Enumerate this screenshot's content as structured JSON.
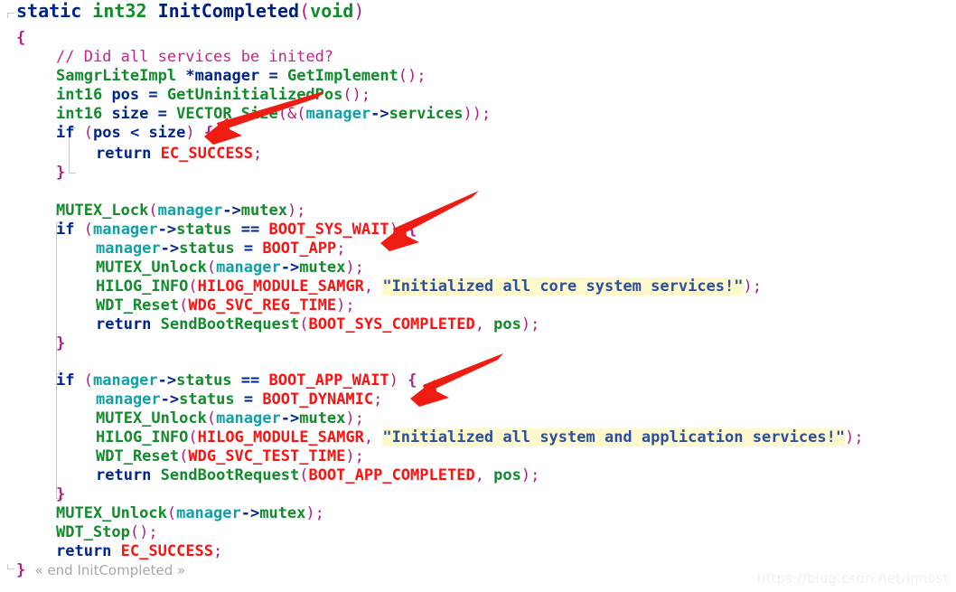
{
  "editor": {
    "language": "C",
    "background_color": "#ffffff",
    "fold_marker": "« end InitCompleted »"
  },
  "theme": {
    "keyword_color": "#00258c",
    "type_color": "#128b2b",
    "function_color": "#128b2b",
    "constant_color": "#ff1111",
    "punctuation_color": "#b0208c",
    "comment_color": "#c2258a",
    "string_color": "#2b4fa2",
    "string_highlight_bg": "#fdf9cc",
    "field_color": "#0fa0a8",
    "fold_guide_color": "#c8c8c8",
    "annotation_color": "#ee1c12",
    "watermark_color": "#f0f0f0"
  },
  "code": {
    "line01": {
      "kw_static": "static",
      "type_int32": "int32",
      "fn_name": "InitCompleted",
      "paren_open": "(",
      "type_void": "void",
      "paren_close": ")"
    },
    "line02": {
      "brace_open": "{"
    },
    "line03": {
      "comment": "// Did all services be inited?"
    },
    "line04": {
      "type": "SamgrLiteImpl",
      "star": "*",
      "var": "manager",
      "eq": "=",
      "fn": "GetImplement",
      "tail": "();"
    },
    "line05": {
      "type": "int16",
      "var": "pos",
      "eq": "=",
      "fn": "GetUninitializedPos",
      "tail": "();"
    },
    "line06": {
      "type": "int16",
      "var": "size",
      "eq": "=",
      "fn": "VECTOR_Size",
      "open": "(&(",
      "obj": "manager",
      "arrow": "->",
      "member": "services",
      "close": "));"
    },
    "line07": {
      "kw_if": "if",
      "open": "(",
      "a": "pos",
      "op": "<",
      "b": "size",
      "close": ")",
      "brace": "{"
    },
    "line08": {
      "kw_return": "return",
      "const": "EC_SUCCESS",
      "semi": ";"
    },
    "line09": {
      "brace_close": "}"
    },
    "line11": {
      "fn": "MUTEX_Lock",
      "open": "(",
      "obj": "manager",
      "arrow": "->",
      "member": "mutex",
      "close": ");"
    },
    "line12": {
      "kw_if": "if",
      "open": "(",
      "obj": "manager",
      "arrow": "->",
      "member": "status",
      "op": "==",
      "const": "BOOT_SYS_WAIT",
      "close": ")",
      "brace": "{"
    },
    "line13": {
      "obj": "manager",
      "arrow": "->",
      "member": "status",
      "eq": "=",
      "const": "BOOT_APP",
      "semi": ";"
    },
    "line14": {
      "fn": "MUTEX_Unlock",
      "open": "(",
      "obj": "manager",
      "arrow": "->",
      "member": "mutex",
      "close": ");"
    },
    "line15": {
      "fn": "HILOG_INFO",
      "open": "(",
      "const": "HILOG_MODULE_SAMGR",
      "comma": ", ",
      "string": "\"Initialized all core system services!\"",
      "close": ");"
    },
    "line16": {
      "fn": "WDT_Reset",
      "open": "(",
      "const": "WDG_SVC_REG_TIME",
      "close": ");"
    },
    "line17": {
      "kw_return": "return",
      "fn": "SendBootRequest",
      "open": "(",
      "const": "BOOT_SYS_COMPLETED",
      "comma": ", ",
      "var": "pos",
      "close": ");"
    },
    "line18": {
      "brace_close": "}"
    },
    "line20": {
      "kw_if": "if",
      "open": "(",
      "obj": "manager",
      "arrow": "->",
      "member": "status",
      "op": "==",
      "const": "BOOT_APP_WAIT",
      "close": ")",
      "brace": "{"
    },
    "line21": {
      "obj": "manager",
      "arrow": "->",
      "member": "status",
      "eq": "=",
      "const": "BOOT_DYNAMIC",
      "semi": ";"
    },
    "line22": {
      "fn": "MUTEX_Unlock",
      "open": "(",
      "obj": "manager",
      "arrow": "->",
      "member": "mutex",
      "close": ");"
    },
    "line23": {
      "fn": "HILOG_INFO",
      "open": "(",
      "const": "HILOG_MODULE_SAMGR",
      "comma": ", ",
      "string": "\"Initialized all system and application services!\"",
      "close": ");"
    },
    "line24": {
      "fn": "WDT_Reset",
      "open": "(",
      "const": "WDG_SVC_TEST_TIME",
      "close": ");"
    },
    "line25": {
      "kw_return": "return",
      "fn": "SendBootRequest",
      "open": "(",
      "const": "BOOT_APP_COMPLETED",
      "comma": ", ",
      "var": "pos",
      "close": ");"
    },
    "line26": {
      "brace_close": "}"
    },
    "line27": {
      "fn": "MUTEX_Unlock",
      "open": "(",
      "obj": "manager",
      "arrow": "->",
      "member": "mutex",
      "close": ");"
    },
    "line28": {
      "fn": "WDT_Stop",
      "tail": "();"
    },
    "line29": {
      "kw_return": "return",
      "const": "EC_SUCCESS",
      "semi": ";"
    },
    "line30": {
      "brace_close": "}",
      "fold": "« end InitCompleted »"
    }
  },
  "annotations": [
    {
      "name": "arrow-to-if-pos-less-size",
      "points_at": "if (pos < size) {"
    },
    {
      "name": "arrow-to-boot-app-assign",
      "points_at": "manager->status = BOOT_APP;"
    },
    {
      "name": "arrow-to-boot-dynamic-assign",
      "points_at": "manager->status = BOOT_DYNAMIC;"
    }
  ],
  "watermark": {
    "text": "https://blog.csdn.net/Innost"
  }
}
